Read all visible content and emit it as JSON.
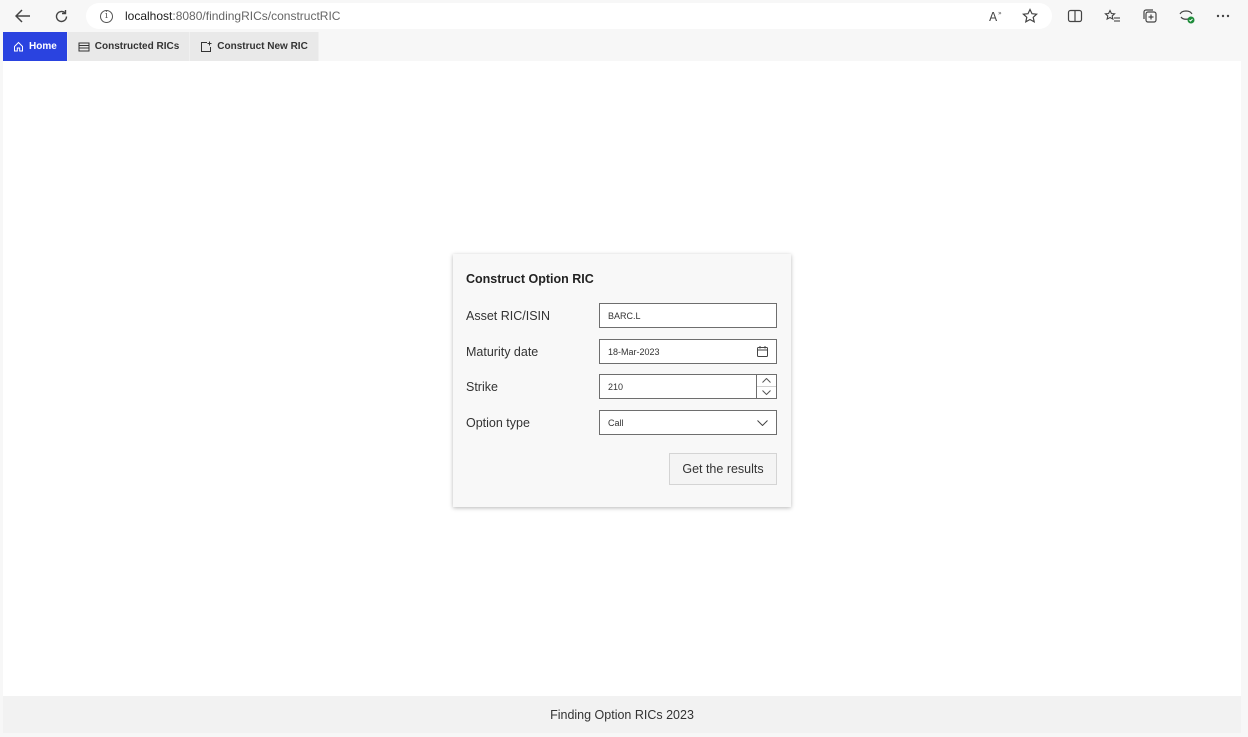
{
  "browser": {
    "url_host": "localhost",
    "url_path": ":8080/findingRICs/constructRIC"
  },
  "tabs": [
    {
      "label": "Home",
      "active": true,
      "icon": "home-icon"
    },
    {
      "label": "Constructed RICs",
      "active": false,
      "icon": "database-icon"
    },
    {
      "label": "Construct New RIC",
      "active": false,
      "icon": "new-document-icon"
    }
  ],
  "form": {
    "title": "Construct Option RIC",
    "asset_label": "Asset RIC/ISIN",
    "asset_value": "BARC.L",
    "maturity_label": "Maturity date",
    "maturity_value": "18-Mar-2023",
    "strike_label": "Strike",
    "strike_value": "210",
    "option_type_label": "Option type",
    "option_type_value": "Call",
    "submit_label": "Get the results"
  },
  "footer": {
    "text": "Finding Option RICs 2023"
  },
  "colors": {
    "accent": "#2a43e0"
  }
}
